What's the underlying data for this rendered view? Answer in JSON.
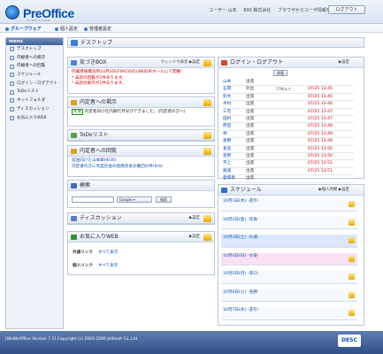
{
  "app": {
    "logo": "PreOffice",
    "logo_sub": "For New Contents",
    "user_label": "ユーザー:山本",
    "company": "800 株式会社",
    "browser_notice": "ブラウザからユーザ情報を削除",
    "logout": "ログアウト"
  },
  "nav": [
    {
      "label": "グループウェア"
    },
    {
      "label": "個人設定"
    },
    {
      "label": "管理者設定"
    }
  ],
  "sidebar": {
    "title": "menu",
    "items": [
      {
        "label": "デスクトップ"
      },
      {
        "label": "内線者への掲示"
      },
      {
        "label": "内線者への回覧"
      },
      {
        "label": "スケジュール"
      },
      {
        "label": "ログイン・ログアウト"
      },
      {
        "label": "ToDoリスト"
      },
      {
        "label": "ネットフォルダ"
      },
      {
        "label": "ディスカッション"
      },
      {
        "label": "お気に入りWEB"
      }
    ]
  },
  "main_title": "デスクトップ",
  "box": {
    "title": "気づきBOX",
    "links": "ウィンドウ表示 ▶設定",
    "lines": [
      "内蔵者様橋治所10月3日(FW630の)480DIRホールにて開催!",
      "* 未読の回覧が2件あります。",
      "* 未読の掲示が1件あります。"
    ]
  },
  "notice": {
    "title": "内定者への掲示",
    "badge": "新着",
    "text": "内定者向け社内期行月号ができました。(内定者の方へ)"
  },
  "todo": {
    "title": "ToDoリスト"
  },
  "circular": {
    "title": "内定者への回覧",
    "items": [
      "前送向けた山本卿(9/30)",
      "内定者の方に年度社長の提携改会文権回の件(9/4)"
    ]
  },
  "search": {
    "title": "検索",
    "engine": "Google",
    "button": "検索"
  },
  "discussion": {
    "title": "ディスカッション",
    "links": "▶設定"
  },
  "favorites": {
    "title": "お気に入りWEB",
    "links": "▶設定",
    "rows": [
      {
        "label": "共通リンク",
        "action": "すべて表示"
      },
      {
        "label": "個人リンク",
        "action": "すべて表示"
      }
    ]
  },
  "login": {
    "title": "ログイン・ログアウト",
    "links": "▶設定",
    "button": "帰電",
    "rows": [
      {
        "name": "山本",
        "status": "出席",
        "note": "",
        "time": ""
      },
      {
        "name": "石岡",
        "status": "外出",
        "note": "17時まで",
        "time": "07/25 13:45"
      },
      {
        "name": "鈴木",
        "status": "出席",
        "note": "",
        "time": "07/25 13:45"
      },
      {
        "name": "木村",
        "status": "出席",
        "note": "",
        "time": "07/25 13:46"
      },
      {
        "name": "三宅",
        "status": "出席",
        "note": "",
        "time": "07/25 13:47"
      },
      {
        "name": "田村",
        "status": "出席",
        "note": "",
        "time": "07/25 13:47"
      },
      {
        "name": "原田",
        "status": "出席",
        "note": "",
        "time": "07/25 13:48"
      },
      {
        "name": "林",
        "status": "出席",
        "note": "",
        "time": "07/25 13:49"
      },
      {
        "name": "倉野",
        "status": "出席",
        "note": "",
        "time": "07/25 13:49"
      },
      {
        "name": "長島",
        "status": "出席",
        "note": "",
        "time": "07/25 13:50"
      },
      {
        "name": "星野",
        "status": "出席",
        "note": "",
        "time": "07/25 13:50"
      },
      {
        "name": "平上",
        "status": "出席",
        "note": "",
        "time": "07/25 13:51"
      },
      {
        "name": "幾波",
        "status": "出席",
        "note": "",
        "time": "07/25 13:51"
      },
      {
        "name": "愛場奏",
        "status": "出席",
        "note": "",
        "time": ""
      }
    ]
  },
  "schedule": {
    "title": "スケジュール",
    "links": "▶個人月間 ▶設定",
    "rows": [
      {
        "date": "10月1日(木)",
        "label": "-友引-",
        "highlight": false
      },
      {
        "date": "10月2日(金)",
        "label": "-先負-",
        "highlight": false
      },
      {
        "date": "10月3日(土)",
        "label": "-仏滅-",
        "highlight": true
      },
      {
        "date": "10月4日(日)",
        "label": "-大安-",
        "highlight": "pink"
      },
      {
        "date": "10月5日(月)",
        "label": "-赤口-",
        "highlight": false
      },
      {
        "date": "10月6日(火)",
        "label": "-先勝-",
        "highlight": false
      },
      {
        "date": "10月7日(水)",
        "label": "-友引-",
        "highlight": false
      }
    ]
  },
  "footer": {
    "text": "[WeWeOffice Version 7.1] Copyright (c) 2003-2009 Jellonet Co.,Ltd",
    "logo": "DESC"
  }
}
